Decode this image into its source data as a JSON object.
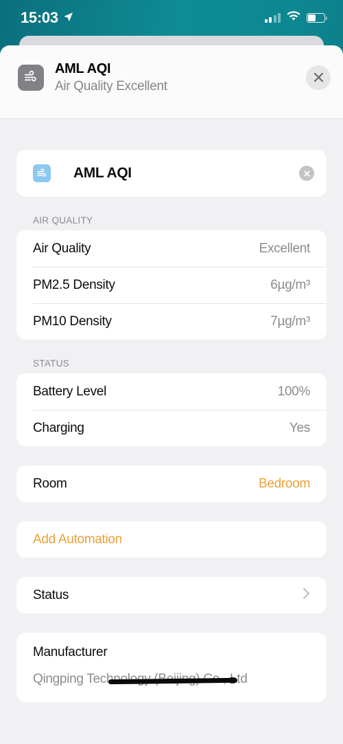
{
  "status_bar": {
    "time": "15:03",
    "location_icon": "location-arrow-icon",
    "cellular_icon": "cellular-signal-icon",
    "wifi_icon": "wifi-icon",
    "battery_icon": "battery-icon"
  },
  "header": {
    "icon": "air-quality-wind-icon",
    "title": "AML AQI",
    "subtitle": "Air Quality Excellent",
    "close_icon": "close-icon"
  },
  "name_card": {
    "icon": "air-quality-wind-icon",
    "value": "AML AQI",
    "clear_icon": "clear-text-icon"
  },
  "sections": [
    {
      "label": "AIR QUALITY",
      "rows": [
        {
          "label": "Air Quality",
          "value": "Excellent"
        },
        {
          "label": "PM2.5 Density",
          "value": "6µg/m³"
        },
        {
          "label": "PM10 Density",
          "value": "7µg/m³"
        }
      ]
    },
    {
      "label": "STATUS",
      "rows": [
        {
          "label": "Battery Level",
          "value": "100%"
        },
        {
          "label": "Charging",
          "value": "Yes"
        }
      ]
    }
  ],
  "room_row": {
    "label": "Room",
    "value": "Bedroom"
  },
  "add_automation": {
    "label": "Add Automation"
  },
  "status_row": {
    "label": "Status",
    "chevron_icon": "chevron-right-icon"
  },
  "manufacturer": {
    "label": "Manufacturer",
    "value": "Qingping Technology (Beijing) Co., Ltd",
    "redaction": "black-strikethrough-redaction"
  },
  "colors": {
    "background_teal": "#0e8b95",
    "accent_orange": "#eba03a",
    "page_background": "#f1f1f3",
    "card_background": "#ffffff",
    "secondary_text": "#8b8b90",
    "icon_tile_blue": "#8dc8f0",
    "icon_tile_gray": "#808287"
  }
}
